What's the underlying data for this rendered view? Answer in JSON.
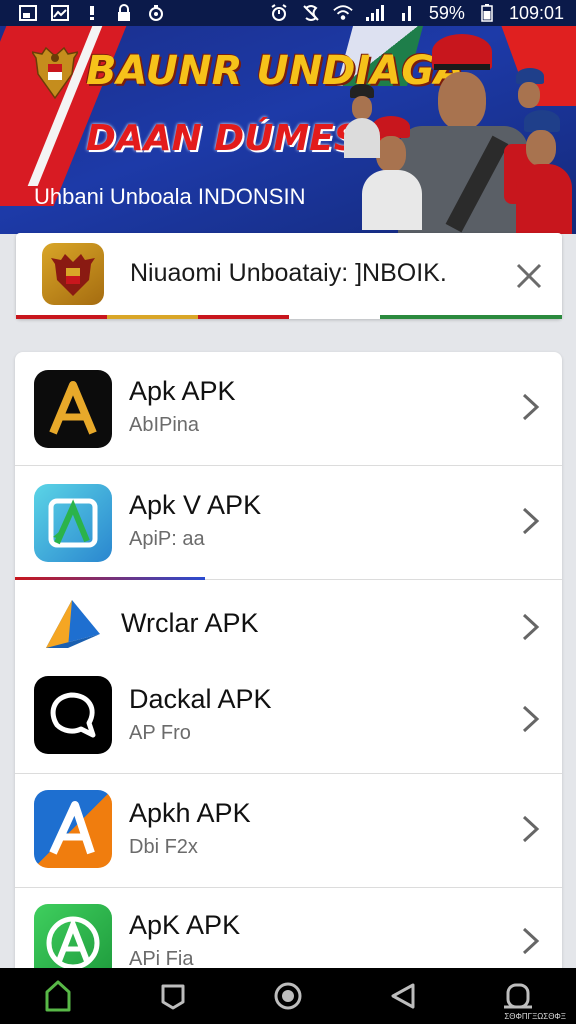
{
  "status_bar": {
    "battery": "59%",
    "time": "109:01"
  },
  "banner": {
    "title_line1": "BAUNR UNDIAGA",
    "title_line2": "DAAN DÚMESIA",
    "subtitle": "Uhbani Unboala INDONSIN"
  },
  "notification": {
    "text": "Niuaomi Unboataiy: ]NBOIK.",
    "close_icon": "close-icon"
  },
  "apps": [
    {
      "name": "Apk APK",
      "subtitle": "AbIPina",
      "icon": "letter-a-black-gold",
      "color": "#000000"
    },
    {
      "name": "Apk V APK",
      "subtitle": "ApiP: aa",
      "icon": "letter-a-teal-square",
      "color": "#27a7d6"
    },
    {
      "name": "Wrclar APK",
      "subtitle": "",
      "icon": "blue-orange-triangle",
      "color": "#1e6fd0"
    },
    {
      "name": "Dackal APK",
      "subtitle": "AP Fro",
      "icon": "chat-bubble-black",
      "color": "#000000"
    },
    {
      "name": "Apkh APK",
      "subtitle": "Dbi F2x",
      "icon": "letter-a-blue-orange",
      "color": "#f07d0e"
    },
    {
      "name": "ApK APK",
      "subtitle": "APi Fia",
      "icon": "letter-a-green",
      "color": "#2bb34b"
    }
  ],
  "nav": {
    "home": "home-icon",
    "back_square": "square-icon",
    "circle": "circle-home-icon",
    "back": "back-triangle-icon",
    "recent": "recent-icon"
  },
  "watermark": "ΣΘΦΠΓΞΩΣΘΦΞ"
}
